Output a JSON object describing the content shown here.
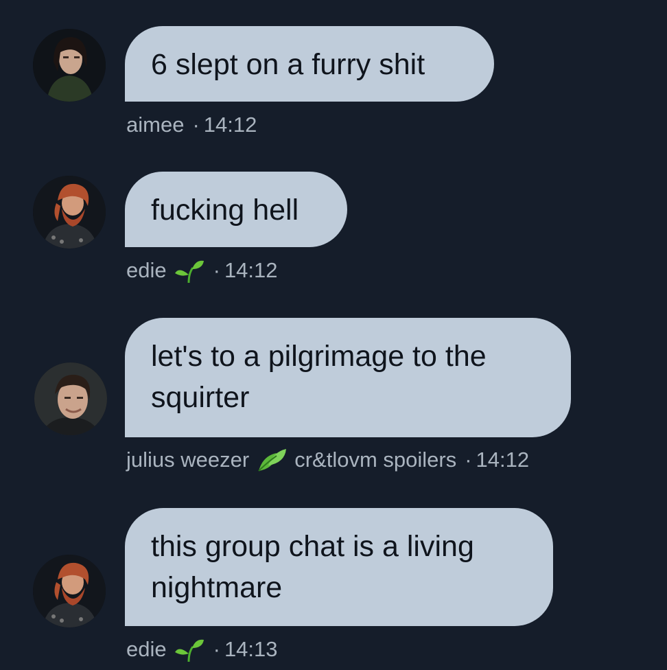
{
  "messages": [
    {
      "text": "6 slept on a furry shit",
      "author": "aimee",
      "dot": "·",
      "time": "14:12",
      "subtitle": "",
      "avatar_icon": "dark-haired-man-avatar"
    },
    {
      "text": "fucking hell",
      "author": "edie",
      "dot": "·",
      "time": "14:12",
      "subtitle": "",
      "avatar_icon": "red-bearded-man-avatar",
      "badge_icon": "seedling-icon"
    },
    {
      "text": "let's to a pilgrimage to the squirter",
      "author": "julius weezer",
      "dot": "·",
      "time": "14:12",
      "subtitle": "cr&tlovm spoilers",
      "avatar_icon": "smiling-man-avatar",
      "badge_icon": "leaves-icon"
    },
    {
      "text": "this group chat is a living nightmare",
      "author": "edie",
      "dot": "·",
      "time": "14:13",
      "subtitle": "",
      "avatar_icon": "red-bearded-man-avatar",
      "badge_icon": "seedling-icon"
    }
  ],
  "colors": {
    "background": "#151d2a",
    "bubble": "#bfccda",
    "bubble_text": "#0f141c",
    "meta_text": "#aab4bf"
  }
}
